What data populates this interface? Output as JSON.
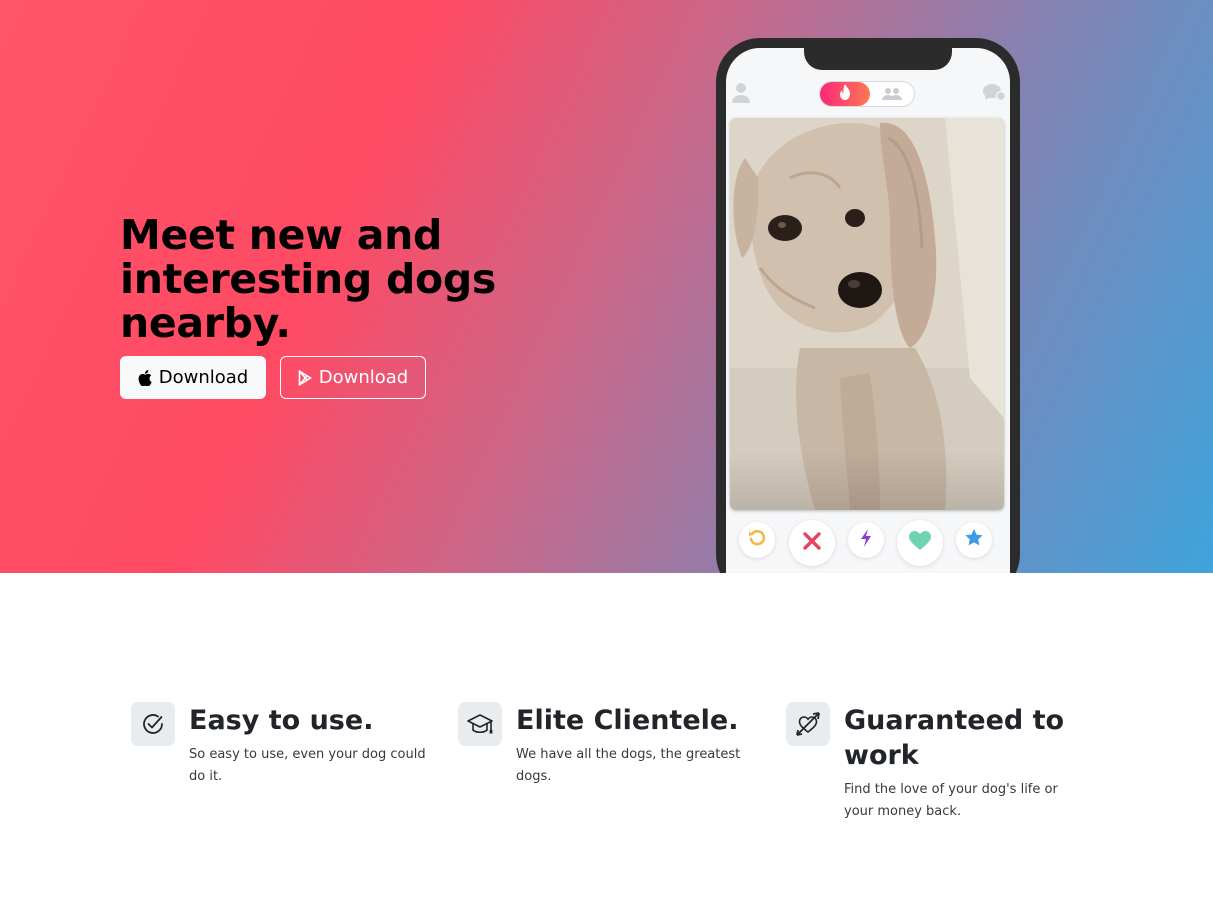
{
  "hero": {
    "headline": "Meet new and interesting dogs nearby.",
    "buttons": [
      {
        "label": "Download",
        "icon": "apple-icon"
      },
      {
        "label": "Download",
        "icon": "google-play-icon"
      }
    ]
  },
  "phone": {
    "top_icons": [
      "profile-icon",
      "flame-icon",
      "group-icon",
      "chat-icon"
    ],
    "actions": [
      "rewind-icon",
      "nope-icon",
      "boost-icon",
      "like-icon",
      "super-like-icon"
    ]
  },
  "features": [
    {
      "icon": "check-circle-icon",
      "title": "Easy to use.",
      "text": "So easy to use, even your dog could do it."
    },
    {
      "icon": "graduation-cap-icon",
      "title": "Elite Clientele.",
      "text": "We have all the dogs, the greatest dogs."
    },
    {
      "icon": "heart-arrow-icon",
      "title": "Guaranteed to work",
      "text": "Find the love of your dog's life or your money back."
    }
  ],
  "colors": {
    "gradient_start": "#ff5469",
    "gradient_end": "#3fa3dc",
    "tinder_pink": "#fd267a",
    "nope_red": "#e8445e",
    "like_green": "#6fd3b0",
    "rewind_yellow": "#f5b748",
    "boost_purple": "#8a3fca",
    "superlike_blue": "#3d9be9"
  }
}
